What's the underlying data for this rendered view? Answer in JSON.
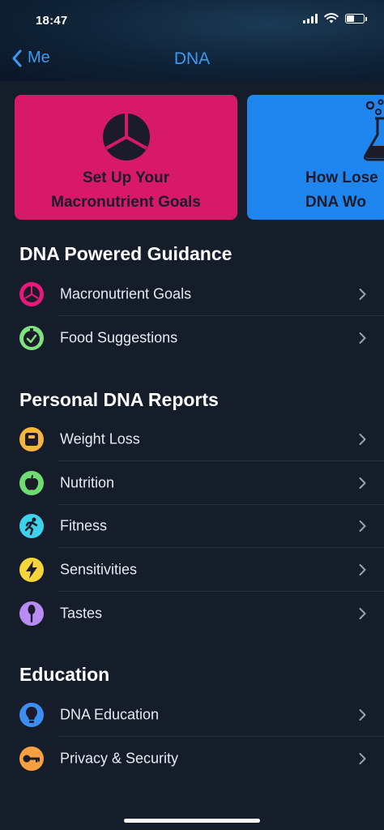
{
  "status": {
    "time": "18:47"
  },
  "nav": {
    "back_label": "Me",
    "title": "DNA"
  },
  "cards": [
    {
      "title": "Set Up Your\nMacronutrient Goals",
      "color": "#d8196a",
      "icon": "pie-chart-icon"
    },
    {
      "title": "How Lose\nDNA Wo",
      "color": "#1f86f0",
      "icon": "flask-icon"
    }
  ],
  "sections": [
    {
      "title": "DNA Powered Guidance",
      "items": [
        {
          "label": "Macronutrient Goals",
          "icon": "macro-pie-icon",
          "icon_color": "#e8197a"
        },
        {
          "label": "Food Suggestions",
          "icon": "stopwatch-check-icon",
          "icon_color": "#7fe27f"
        }
      ]
    },
    {
      "title": "Personal DNA Reports",
      "items": [
        {
          "label": "Weight Loss",
          "icon": "scale-icon",
          "icon_color": "#f6b53e"
        },
        {
          "label": "Nutrition",
          "icon": "apple-icon",
          "icon_color": "#6fdc72"
        },
        {
          "label": "Fitness",
          "icon": "runner-icon",
          "icon_color": "#3ed2ea"
        },
        {
          "label": "Sensitivities",
          "icon": "lightning-icon",
          "icon_color": "#f5d63a"
        },
        {
          "label": "Tastes",
          "icon": "spoon-icon",
          "icon_color": "#b98cf5"
        }
      ]
    },
    {
      "title": "Education",
      "items": [
        {
          "label": "DNA Education",
          "icon": "lightbulb-icon",
          "icon_color": "#3b8ff0"
        },
        {
          "label": "Privacy & Security",
          "icon": "key-icon",
          "icon_color": "#f6a042"
        }
      ]
    }
  ]
}
